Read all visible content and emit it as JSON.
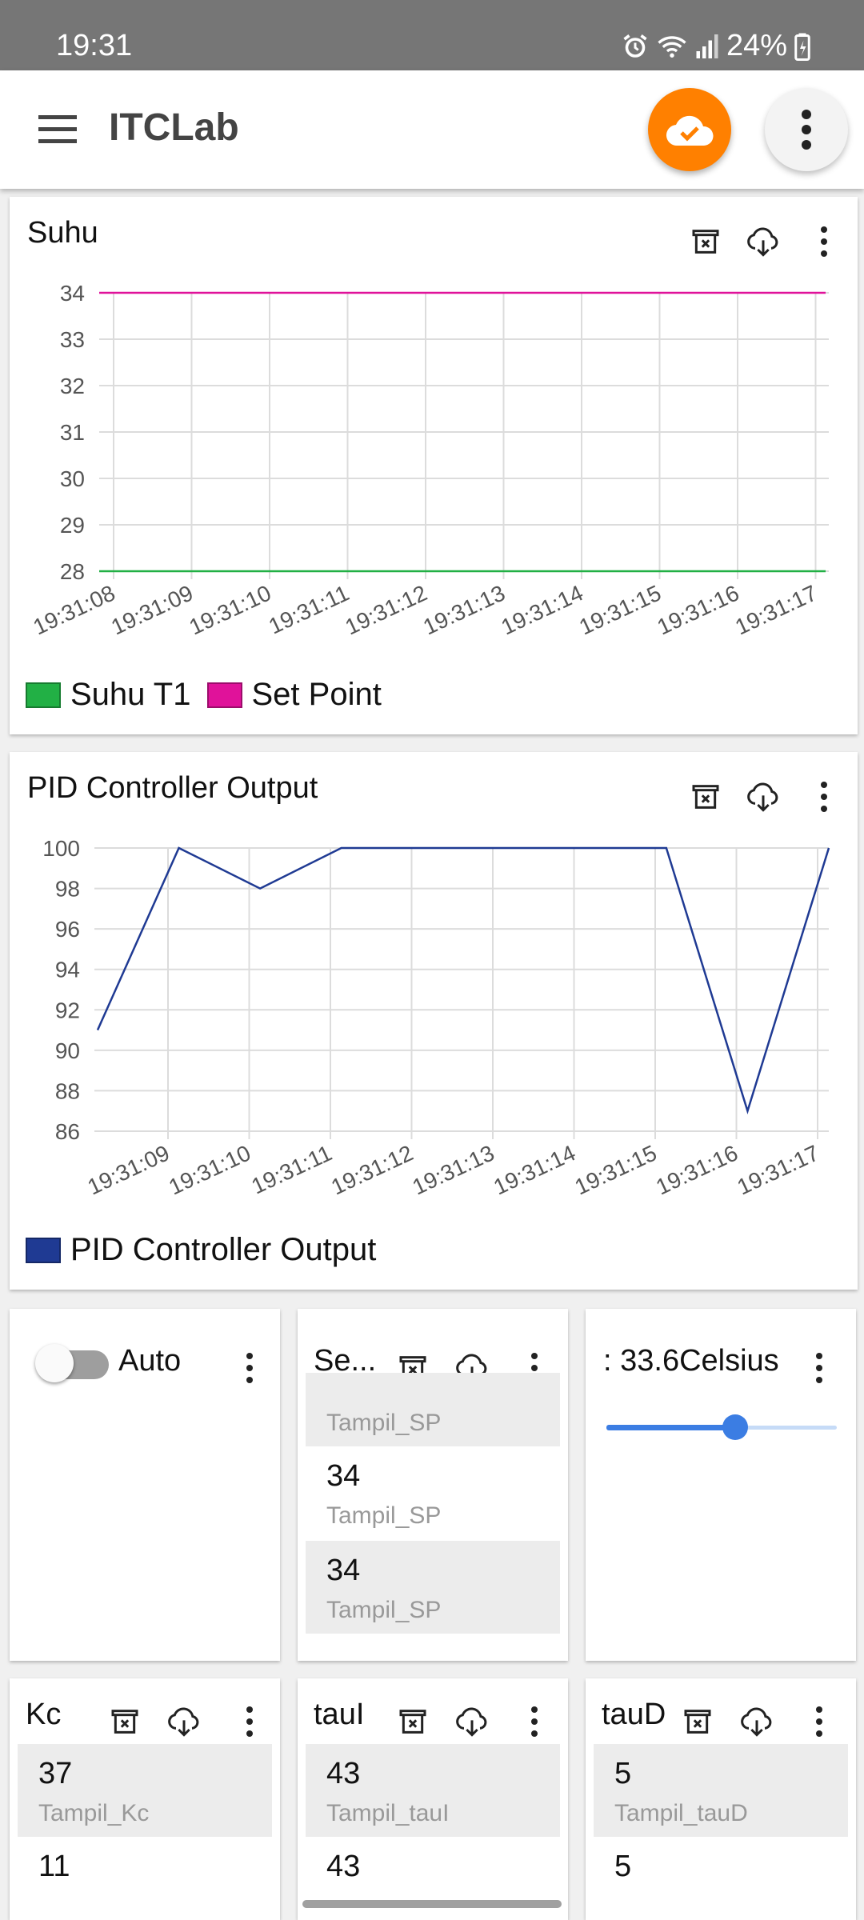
{
  "status_bar": {
    "time": "19:31",
    "battery": "24%"
  },
  "app_bar": {
    "title": "ITCLab"
  },
  "suhu_chart": {
    "title": "Suhu",
    "chart_data": {
      "type": "line",
      "x": [
        "19:31:08",
        "19:31:09",
        "19:31:10",
        "19:31:11",
        "19:31:12",
        "19:31:13",
        "19:31:14",
        "19:31:15",
        "19:31:16",
        "19:31:17"
      ],
      "ylim": [
        28,
        34
      ],
      "yticks": [
        34,
        33,
        32,
        31,
        30,
        29,
        28
      ],
      "series": [
        {
          "name": "Suhu T1",
          "color": "#22b045",
          "values": [
            28,
            28,
            28,
            28,
            28,
            28,
            28,
            28,
            28,
            28
          ]
        },
        {
          "name": "Set Point",
          "color": "#e0129a",
          "values": [
            34,
            34,
            34,
            34,
            34,
            34,
            34,
            34,
            34,
            34
          ]
        }
      ],
      "grid": true,
      "legend": "bottom-left"
    }
  },
  "pid_chart": {
    "title": "PID Controller Output",
    "chart_data": {
      "type": "line",
      "x": [
        "19:31:09",
        "19:31:10",
        "19:31:11",
        "19:31:12",
        "19:31:13",
        "19:31:14",
        "19:31:15",
        "19:31:16",
        "19:31:17"
      ],
      "ylim": [
        86,
        100
      ],
      "yticks": [
        100,
        98,
        96,
        94,
        92,
        90,
        88,
        86
      ],
      "series": [
        {
          "name": "PID Controller Output",
          "color": "#1f3a93",
          "values": [
            91,
            100,
            98,
            100,
            100,
            100,
            100,
            100,
            87,
            100
          ]
        }
      ],
      "grid": true,
      "legend": "bottom-left"
    }
  },
  "auto_card": {
    "label": "Auto",
    "toggle_on": false
  },
  "setpoint_card": {
    "title": "Se...",
    "items": [
      {
        "value": "",
        "label": "Tampil_SP"
      },
      {
        "value": "34",
        "label": "Tampil_SP"
      },
      {
        "value": "34",
        "label": "Tampil_SP"
      },
      {
        "value": "34",
        "label": ""
      }
    ]
  },
  "slider_card": {
    "title": ": 33.6Celsius",
    "slider_fraction": 0.56
  },
  "kc_card": {
    "title": "Kc",
    "items": [
      {
        "value": "37",
        "label": "Tampil_Kc"
      },
      {
        "value": "11",
        "label": ""
      }
    ]
  },
  "taui_card": {
    "title": "tauI",
    "items": [
      {
        "value": "43",
        "label": "Tampil_tauI"
      },
      {
        "value": "43",
        "label": ""
      }
    ]
  },
  "taud_card": {
    "title": "tauD",
    "items": [
      {
        "value": "5",
        "label": "Tampil_tauD"
      },
      {
        "value": "5",
        "label": ""
      }
    ]
  }
}
